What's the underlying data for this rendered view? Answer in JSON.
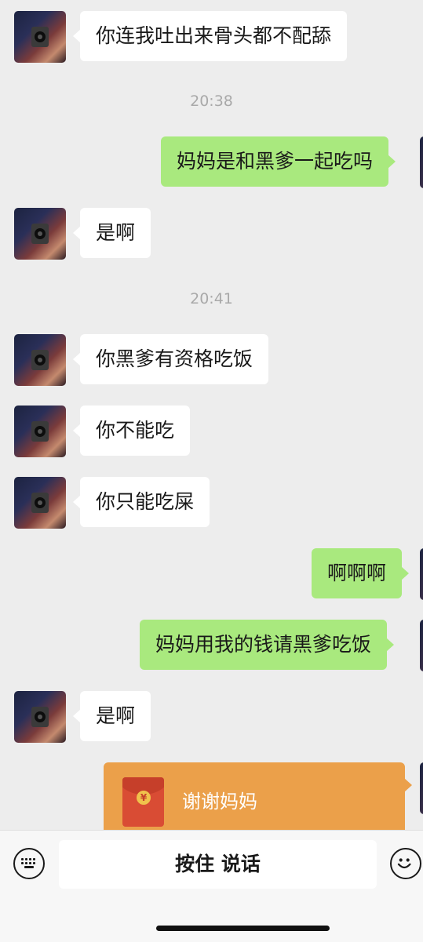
{
  "messages": [
    {
      "side": "in",
      "text": "你连我吐出来骨头都不配舔"
    },
    {
      "type": "time",
      "text": "20:38"
    },
    {
      "side": "out",
      "text": "妈妈是和黑爹一起吃吗"
    },
    {
      "side": "in",
      "text": "是啊"
    },
    {
      "type": "time",
      "text": "20:41"
    },
    {
      "side": "in",
      "text": "你黑爹有资格吃饭"
    },
    {
      "side": "in",
      "text": "你不能吃"
    },
    {
      "side": "in",
      "text": "你只能吃屎"
    },
    {
      "side": "out",
      "text": "啊啊啊"
    },
    {
      "side": "out",
      "text": "妈妈用我的钱请黑爹吃饭"
    },
    {
      "side": "in",
      "text": "是啊"
    }
  ],
  "red_packet": {
    "title": "谢谢妈妈",
    "icon": "red-envelope-icon",
    "coin_symbol": "¥"
  },
  "input_bar": {
    "talk_label": "按住 说话",
    "left_icon": "keyboard-icon",
    "right_icon": "emoji-icon"
  },
  "colors": {
    "incoming": "#ffffff",
    "outgoing": "#a9e97e",
    "red_packet": "#eba04a",
    "background": "#ededed"
  }
}
